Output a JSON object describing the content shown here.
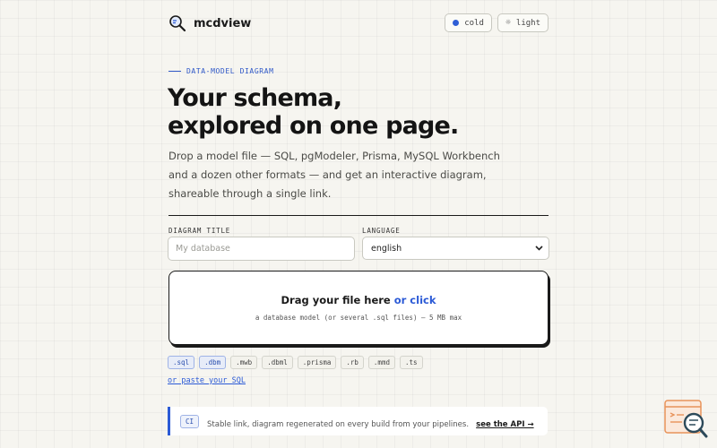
{
  "app": {
    "name": "mcdview"
  },
  "theme": {
    "palette_label": "cold",
    "mode_label": "light",
    "accent": "#2b5ad6"
  },
  "hero": {
    "eyebrow": "DATA-MODEL DIAGRAM",
    "headline_line1": "Your schema,",
    "headline_line2": "explored on one page.",
    "lead": "Drop a model file — SQL, pgModeler, Prisma, MySQL Workbench and a dozen other formats — and get an interactive diagram, shareable through a single link."
  },
  "form": {
    "title_label": "DIAGRAM TITLE",
    "title_placeholder": "My database",
    "title_value": "",
    "language_label": "LANGUAGE",
    "language_value": "english"
  },
  "dropzone": {
    "title": "Drag your file here",
    "link": "or click",
    "subtitle": "a database model (or several .sql files) — 5 MB max"
  },
  "extensions": [
    {
      "label": ".sql",
      "active": true
    },
    {
      "label": ".dbm",
      "active": true
    },
    {
      "label": ".mwb",
      "active": false
    },
    {
      "label": ".dbml",
      "active": false
    },
    {
      "label": ".prisma",
      "active": false
    },
    {
      "label": ".rb",
      "active": false
    },
    {
      "label": ".mmd",
      "active": false
    },
    {
      "label": ".ts",
      "active": false
    }
  ],
  "paste_link": "or paste your SQL",
  "ci": {
    "badge": "CI",
    "text": "Stable link, diagram regenerated on every build from your pipelines.",
    "link": "see the API →"
  }
}
